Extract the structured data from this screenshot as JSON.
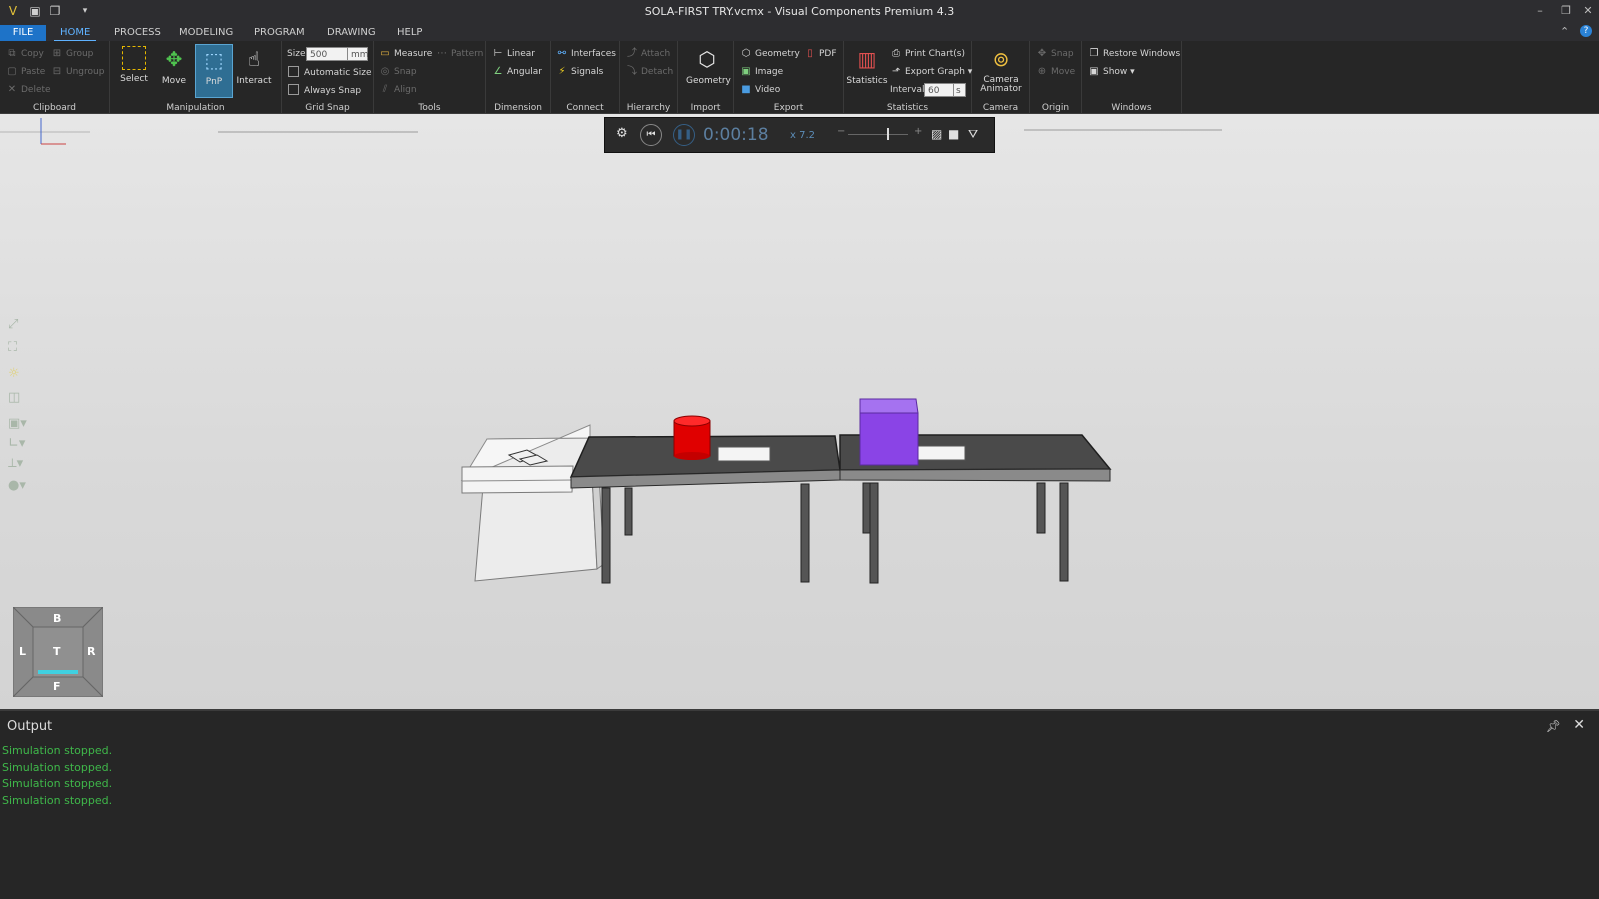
{
  "window": {
    "title": "SOLA-FIRST TRY.vcmx - Visual Components Premium 4.3"
  },
  "tabs": [
    "FILE",
    "HOME",
    "PROCESS",
    "MODELING",
    "PROGRAM",
    "DRAWING",
    "HELP"
  ],
  "ribbon": {
    "clipboard": {
      "label": "Clipboard",
      "copy": "Copy",
      "paste": "Paste",
      "delete": "Delete",
      "group": "Group",
      "ungroup": "Ungroup"
    },
    "manipulation": {
      "label": "Manipulation",
      "select": "Select",
      "move": "Move",
      "pnp": "PnP",
      "interact": "Interact"
    },
    "gridsnap": {
      "label": "Grid Snap",
      "size_label": "Size",
      "size_value": "500",
      "size_unit": "mm",
      "automatic_size": "Automatic Size",
      "always_snap": "Always Snap"
    },
    "tools": {
      "label": "Tools",
      "measure": "Measure",
      "pattern": "Pattern",
      "snap": "Snap",
      "align": "Align"
    },
    "dimension": {
      "label": "Dimension",
      "linear": "Linear",
      "angular": "Angular"
    },
    "connect": {
      "label": "Connect",
      "interfaces": "Interfaces",
      "signals": "Signals"
    },
    "hierarchy": {
      "label": "Hierarchy",
      "attach": "Attach",
      "detach": "Detach"
    },
    "import": {
      "label": "Import",
      "geometry": "Geometry"
    },
    "export": {
      "label": "Export",
      "geometry": "Geometry",
      "pdf": "PDF",
      "image": "Image",
      "video": "Video"
    },
    "statistics": {
      "label": "Statistics",
      "statistics": "Statistics",
      "print_charts": "Print Chart(s)",
      "export_graph": "Export Graph",
      "interval_label": "Interval",
      "interval_value": "60",
      "interval_unit": "s"
    },
    "camera": {
      "label": "Camera",
      "camera_animator_1": "Camera",
      "camera_animator_2": "Animator"
    },
    "origin": {
      "label": "Origin",
      "snap": "Snap",
      "move": "Move"
    },
    "windows": {
      "label": "Windows",
      "restore_windows": "Restore Windows",
      "show": "Show"
    }
  },
  "simulation": {
    "time": "0:00:18",
    "speed": "x 7.2"
  },
  "navcube": {
    "top": "B",
    "left": "L",
    "center": "T",
    "right": "R",
    "bottom": "F"
  },
  "output": {
    "title": "Output",
    "lines": [
      "Simulation stopped.",
      "Simulation stopped.",
      "Simulation stopped.",
      "Simulation stopped."
    ]
  },
  "colors": {
    "accent": "#1e73c8",
    "log_text": "#3fb84a",
    "red_part": "#e00000",
    "purple_part": "#8a44e6"
  }
}
